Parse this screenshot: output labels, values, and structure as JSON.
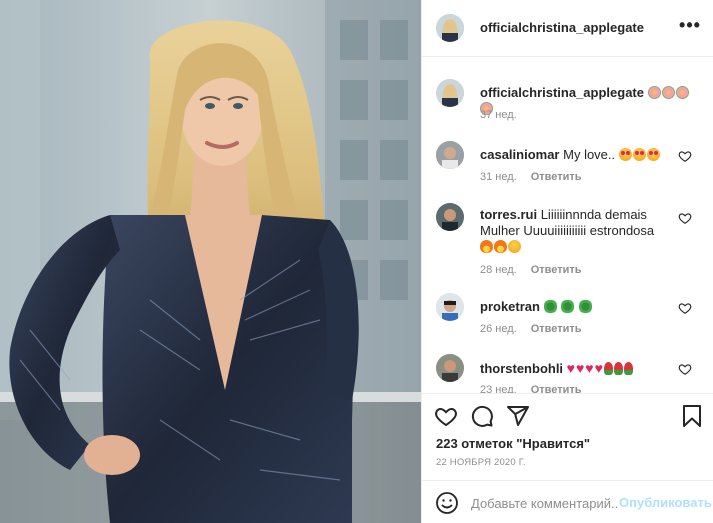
{
  "post": {
    "author": "officialchristina_applegate",
    "caption": {
      "username": "officialchristina_applegate",
      "emojis": [
        "flower",
        "flower",
        "flower",
        "flower"
      ],
      "time": "37 нед."
    }
  },
  "comments": [
    {
      "username": "casaliniomar",
      "text": "My love..",
      "emojis": [
        "lovey",
        "lovey",
        "lovey"
      ],
      "time": "31 нед.",
      "reply_label": "Ответить"
    },
    {
      "username": "torres.rui",
      "text": "Liiiiiinnnda demais Mulher Uuuuiiiiiiiiiii estrondosa",
      "emojis": [
        "fire",
        "fire",
        "blush"
      ],
      "time": "28 нед.",
      "reply_label": "Ответить"
    },
    {
      "username": "proketran",
      "text": "",
      "emojis": [
        "clover",
        "clover",
        "clover"
      ],
      "time": "26 нед.",
      "reply_label": "Ответить"
    },
    {
      "username": "thorstenbohli",
      "text": "",
      "emojis": [
        "heart",
        "heart",
        "heart",
        "heart",
        "rose",
        "rose",
        "rose"
      ],
      "time": "23 нед.",
      "reply_label": "Ответить"
    }
  ],
  "actions": {
    "likes_text": "223 отметок \"Нравится\"",
    "date": "22 НОЯБРЯ 2020 Г."
  },
  "add_comment": {
    "placeholder": "Добавьте комментарий...",
    "publish_label": "Опубликовать"
  },
  "colors": {
    "text": "#262626",
    "secondary": "#8e8e8e",
    "border": "#efefef",
    "publish_disabled": "#b2dffc",
    "dress": "#2b3446"
  },
  "icons": [
    "more-options-icon",
    "heart-icon",
    "comment-icon",
    "share-icon",
    "bookmark-icon",
    "smiley-icon"
  ]
}
